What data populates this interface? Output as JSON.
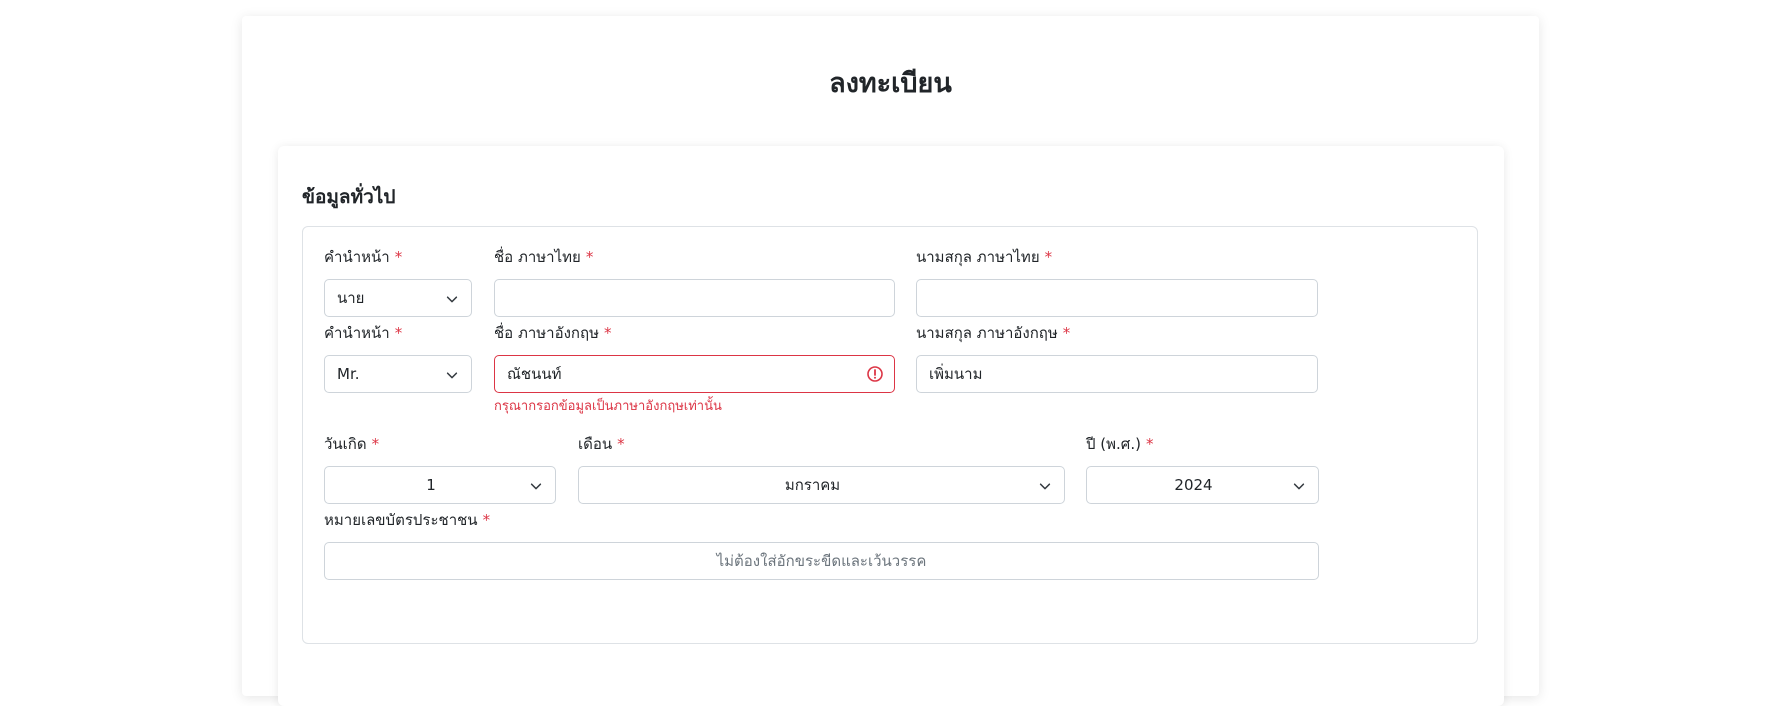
{
  "page": {
    "title": "ลงทะเบียน"
  },
  "section": {
    "title": "ข้อมูลทั่วไป"
  },
  "colors": {
    "required": "#dc3545",
    "error": "#dc3545",
    "border": "#ced4da"
  },
  "form": {
    "row1": {
      "prefix": {
        "label": "คำนำหน้า",
        "required_mark": "*",
        "value": "นาย",
        "icon": "chevron-down-icon"
      },
      "first_name_th": {
        "label": "ชื่อ ภาษาไทย",
        "required_mark": "*",
        "value": ""
      },
      "last_name_th": {
        "label": "นามสกุล ภาษาไทย",
        "required_mark": "*",
        "value": ""
      }
    },
    "row2": {
      "prefix_en": {
        "label": "คำนำหน้า",
        "required_mark": "*",
        "value": "Mr.",
        "icon": "chevron-down-icon"
      },
      "first_name_en": {
        "label": "ชื่อ ภาษาอังกฤษ",
        "required_mark": "*",
        "value": "ณัชนนท์",
        "error": "กรุณากรอกข้อมูลเป็นภาษาอังกฤษเท่านั้น",
        "icon": "alert-circle-icon"
      },
      "last_name_en": {
        "label": "นามสกุล ภาษาอังกฤษ",
        "required_mark": "*",
        "value": "เพิ่มนาม"
      }
    },
    "birth": {
      "day": {
        "label": "วันเกิด",
        "required_mark": "*",
        "value": "1"
      },
      "month": {
        "label": "เดือน",
        "required_mark": "*",
        "value": "มกราคม"
      },
      "year": {
        "label": "ปี (พ.ศ.)",
        "required_mark": "*",
        "value": "2024"
      }
    },
    "id_card": {
      "label": "หมายเลขบัตรประชาชน",
      "required_mark": "*",
      "placeholder": "ไม่ต้องใส่อักขระขีดและเว้นวรรค"
    }
  }
}
